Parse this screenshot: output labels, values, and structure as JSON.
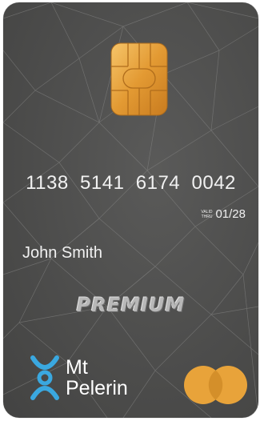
{
  "card": {
    "number": "1138  5141  6174  0042",
    "valid_label_line1": "VALID",
    "valid_label_line2": "THRU",
    "valid_thru": "01/28",
    "holder_name": "John Smith",
    "tier": "PREMIUM"
  },
  "brand": {
    "name_line1": "Mt",
    "name_line2": "Pelerin"
  },
  "colors": {
    "card_background": "#4f4f4e",
    "chip": "#e8a33a",
    "brand_icon": "#3aa8e0",
    "network_logo": "#e8a33a",
    "text": "#f1f1f1"
  },
  "icons": {
    "chip": "emv-chip-icon",
    "brand": "mt-pelerin-logo-icon",
    "network": "card-network-logo-icon"
  }
}
